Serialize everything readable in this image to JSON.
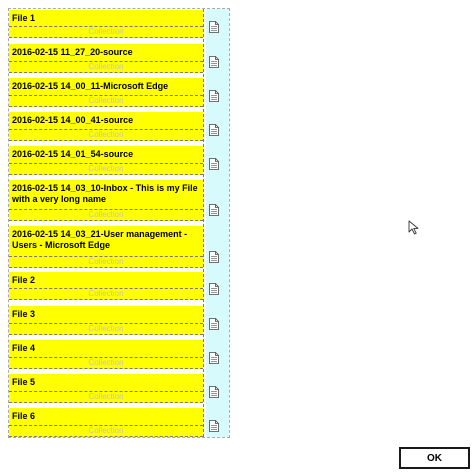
{
  "files": [
    {
      "title": "File 1",
      "collection": "Collection"
    },
    {
      "title": "2016-02-15 11_27_20-source",
      "collection": "Collection"
    },
    {
      "title": "2016-02-15 14_00_11-Microsoft Edge",
      "collection": "Collection"
    },
    {
      "title": "2016-02-15 14_00_41-source",
      "collection": "Collection"
    },
    {
      "title": "2016-02-15 14_01_54-source",
      "collection": "Collection"
    },
    {
      "title": "2016-02-15 14_03_10-Inbox -   This is my File with a very long name",
      "collection": "Collection"
    },
    {
      "title": "2016-02-15 14_03_21-User management - Users - Microsoft Edge",
      "collection": "Collection"
    },
    {
      "title": "File 2",
      "collection": "Collection"
    },
    {
      "title": "File 3",
      "collection": "Collection"
    },
    {
      "title": "File 4",
      "collection": "Collection"
    },
    {
      "title": "File 5",
      "collection": "Collection"
    },
    {
      "title": "File 6",
      "collection": "Collection"
    }
  ],
  "dialog": {
    "ok_label": "OK"
  },
  "icons": {
    "file": "document-icon",
    "pointer": "mouse-cursor-icon"
  },
  "colors": {
    "row_highlight": "#ffff00",
    "side_strip": "#d7fbfd"
  }
}
